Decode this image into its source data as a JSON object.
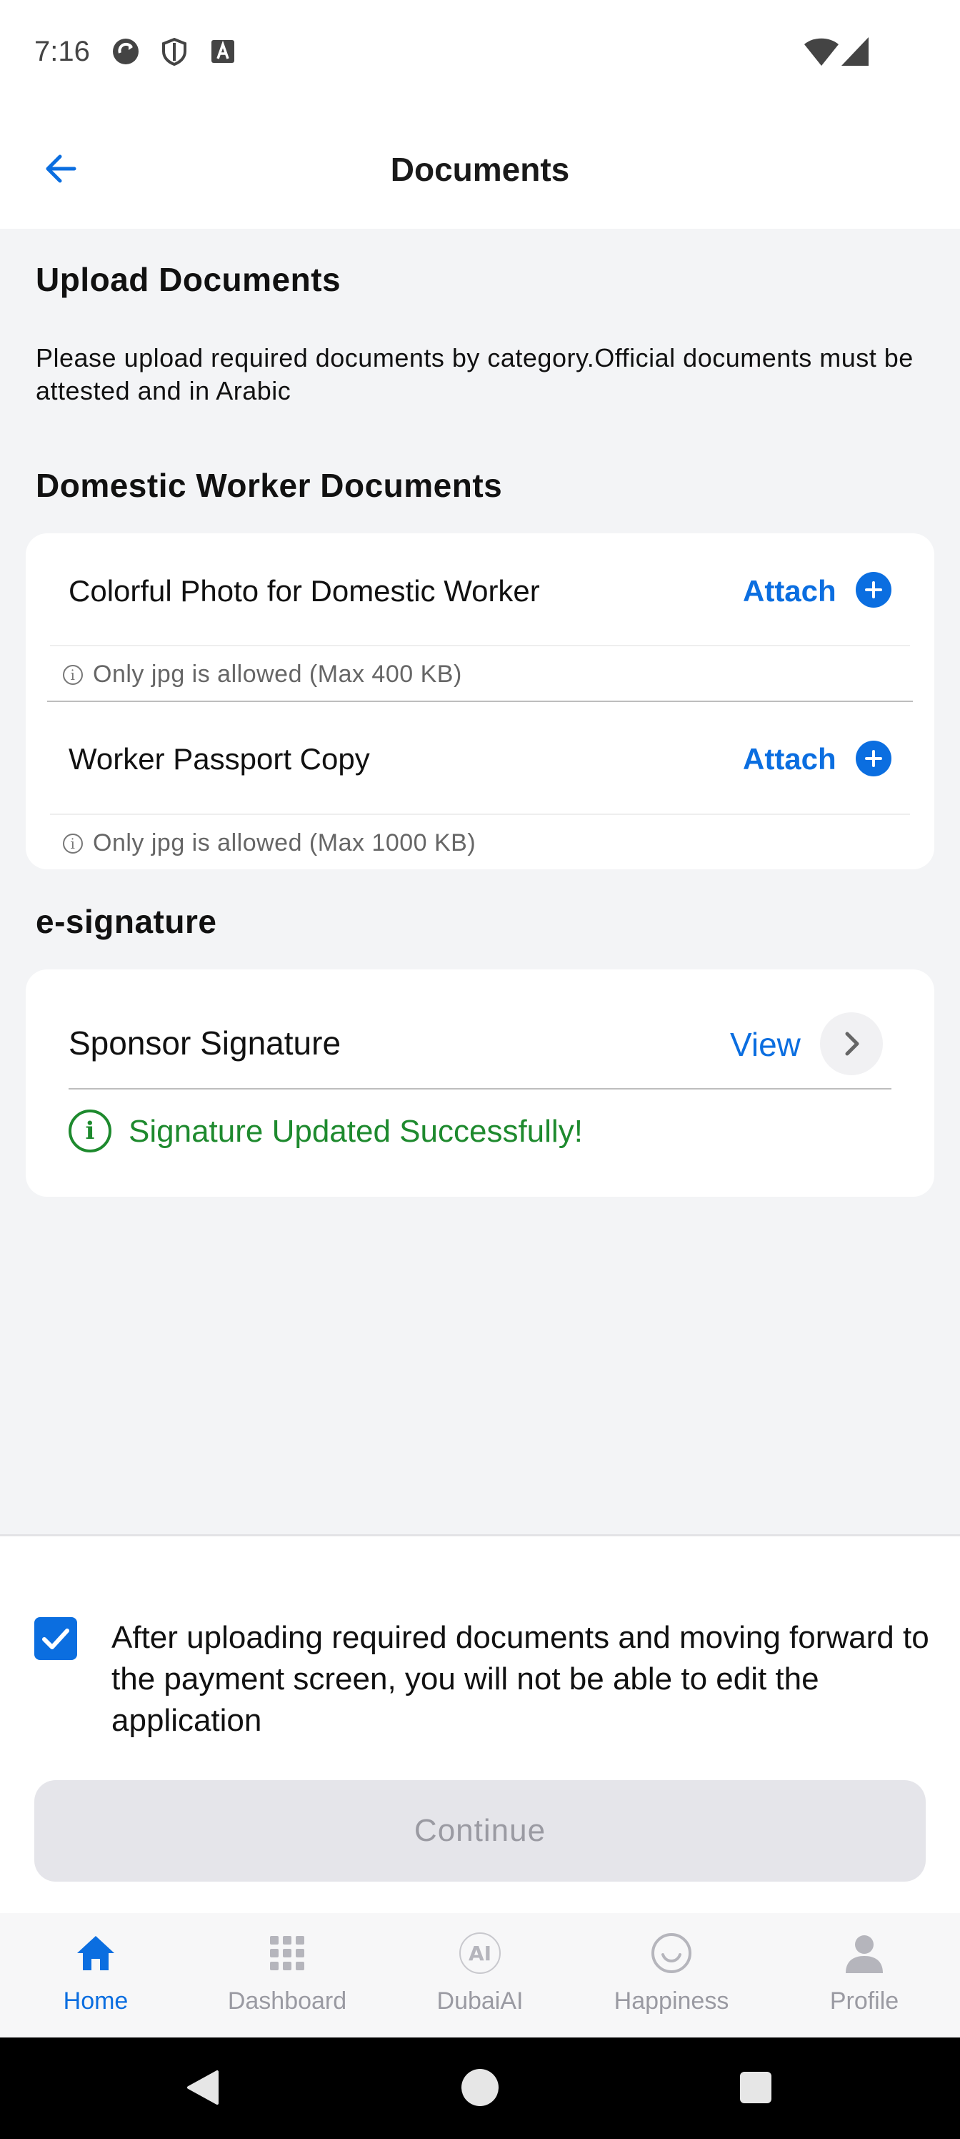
{
  "status_bar": {
    "time": "7:16"
  },
  "header": {
    "title": "Documents"
  },
  "upload": {
    "title": "Upload Documents",
    "description": "Please upload required documents by category.Official documents must be attested and in Arabic"
  },
  "domestic": {
    "title": "Domestic Worker Documents",
    "items": [
      {
        "label": "Colorful Photo for Domestic Worker",
        "action": "Attach",
        "hint": "Only jpg is allowed (Max 400 KB)"
      },
      {
        "label": "Worker Passport Copy",
        "action": "Attach",
        "hint": "Only jpg is allowed (Max 1000 KB)"
      }
    ]
  },
  "esignature": {
    "title": "e-signature",
    "label": "Sponsor Signature",
    "action": "View",
    "status": "Signature Updated Successfully!"
  },
  "consent": {
    "checked": true,
    "text": "After uploading required documents and moving forward to the payment screen, you will not be able to edit the application"
  },
  "continue_label": "Continue",
  "bottom_nav": [
    {
      "label": "Home",
      "icon": "home-icon",
      "active": true
    },
    {
      "label": "Dashboard",
      "icon": "grid-icon",
      "active": false
    },
    {
      "label": "DubaiAI",
      "icon": "ai-icon",
      "active": false
    },
    {
      "label": "Happiness",
      "icon": "smiley-icon",
      "active": false
    },
    {
      "label": "Profile",
      "icon": "person-icon",
      "active": false
    }
  ],
  "colors": {
    "accent": "#0b6ee0",
    "success": "#1e8a2e",
    "background": "#f3f4f6"
  }
}
